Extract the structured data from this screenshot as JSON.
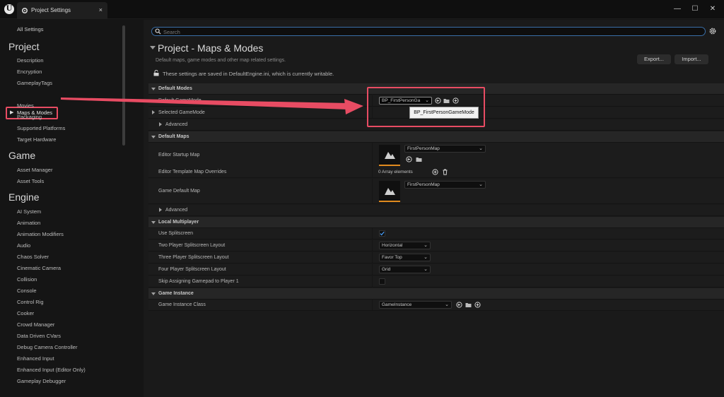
{
  "titlebar": {
    "app_logo": "U",
    "tab_title": "Project Settings",
    "tab_icon": "settings-icon",
    "close_glyph": "×",
    "minimize_glyph": "—",
    "maximize_glyph": "☐",
    "window_close_glyph": "✕"
  },
  "sidebar": {
    "all_settings": "All Settings",
    "sections": [
      {
        "title": "Project",
        "items": [
          "Description",
          "Encryption",
          "GameplayTags",
          "Maps & Modes",
          "Movies",
          "Packaging",
          "Supported Platforms",
          "Target Hardware"
        ]
      },
      {
        "title": "Game",
        "items": [
          "Asset Manager",
          "Asset Tools"
        ]
      },
      {
        "title": "Engine",
        "items": [
          "AI System",
          "Animation",
          "Animation Modifiers",
          "Audio",
          "Chaos Solver",
          "Cinematic Camera",
          "Collision",
          "Console",
          "Control Rig",
          "Cooker",
          "Crowd Manager",
          "Data Driven CVars",
          "Debug Camera Controller",
          "Enhanced Input",
          "Enhanced Input (Editor Only)",
          "Gameplay Debugger"
        ]
      }
    ],
    "selected": "Maps & Modes"
  },
  "search": {
    "placeholder": "Search"
  },
  "header": {
    "title": "Project - Maps & Modes",
    "subtitle": "Default maps, game modes and other map related settings.",
    "writable_note": "These settings are saved in DefaultEngine.ini, which is currently writable.",
    "export_label": "Export...",
    "import_label": "Import..."
  },
  "grid": {
    "default_modes": {
      "section": "Default Modes",
      "default_game_mode_label": "Default GameMode",
      "default_game_mode_value": "BP_FirstPersonGa",
      "selected_game_mode": "Selected GameMode",
      "advanced": "Advanced"
    },
    "default_maps": {
      "section": "Default Maps",
      "editor_startup_map": "Editor Startup Map",
      "editor_startup_map_value": "FirstPersonMap",
      "editor_template_overrides": "Editor Template Map Overrides",
      "array_elements": "0 Array elements",
      "game_default_map": "Game Default Map",
      "game_default_map_value": "FirstPersonMap",
      "advanced": "Advanced"
    },
    "local_multiplayer": {
      "section": "Local Multiplayer",
      "use_splitscreen": "Use Splitscreen",
      "use_splitscreen_checked": true,
      "two_player": "Two Player Splitscreen Layout",
      "two_player_value": "Horizontal",
      "three_player": "Three Player Splitscreen Layout",
      "three_player_value": "Favor Top",
      "four_player": "Four Player Splitscreen Layout",
      "four_player_value": "Grid",
      "skip_gamepad": "Skip Assigning Gamepad to Player 1",
      "skip_gamepad_checked": false
    },
    "game_instance": {
      "section": "Game Instance",
      "class_label": "Game Instance Class",
      "class_value": "GameInstance"
    }
  },
  "tooltip": "BP_FirstPersonGameMode",
  "dropdown_chevron": "⌄",
  "colors": {
    "annotation": "#e84c63",
    "accent_blue": "#3a6ea8",
    "checkbox_check": "#4aa3ff",
    "thumbnail_underline": "#e08a1e"
  }
}
